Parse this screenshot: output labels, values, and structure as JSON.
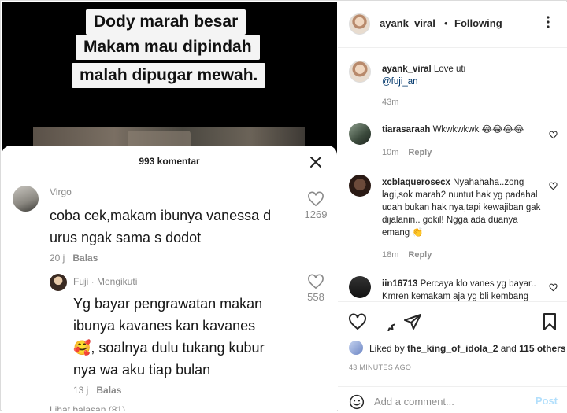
{
  "media": {
    "caption_lines": [
      "Dody marah besar",
      "Makam mau dipindah",
      "malah dipugar mewah."
    ],
    "sheet_title": "993 komentar",
    "comments": [
      {
        "name": "Virgo",
        "text_lines": [
          "coba cek,makam ibunya vanessa d",
          "urus ngak sama s dodot"
        ],
        "time": "20 j",
        "reply": "Balas",
        "likes": "1269"
      },
      {
        "name": "Fuji · Mengikuti",
        "text_lines": [
          "Yg bayar pengrawatan makan",
          "ibunya kavanes kan kavanes",
          "🥰, soalnya dulu tukang kubur",
          "nya wa aku tiap bulan"
        ],
        "time": "13 j",
        "reply": "Balas",
        "likes": "558"
      }
    ],
    "view_replies": "Lihat balasan (81)"
  },
  "panel": {
    "owner": "ayank_viral",
    "dot": "•",
    "following": "Following",
    "caption": {
      "name": "ayank_viral",
      "text": "Love uti",
      "mention": "@fuji_an",
      "time": "43m"
    },
    "comments": [
      {
        "name": "tiarasaraah",
        "text": "Wkwkwkwk 😂😂😂😂",
        "time": "10m",
        "reply": "Reply"
      },
      {
        "name": "xcblaquerosecx",
        "text": "Nyahahaha..zong lagi,sok marah2 nuntut hak yg padahal udah bukan hak nya,tapi kewajiban gak dijalanin.. gokil! Ngga ada duanya emang 👏",
        "time": "18m",
        "reply": "Reply"
      },
      {
        "name": "iin16713",
        "text": "Percaya klo vanes yg bayar.. Kmren kemakam aja yg bli kembang",
        "time": "",
        "reply": ""
      }
    ],
    "liked_prefix": "Liked by",
    "liked_user": "the_king_of_idola_2",
    "liked_and": "and",
    "liked_others": "115 others",
    "time_ago": "43 MINUTES AGO",
    "add_placeholder": "Add a comment...",
    "post_label": "Post"
  }
}
